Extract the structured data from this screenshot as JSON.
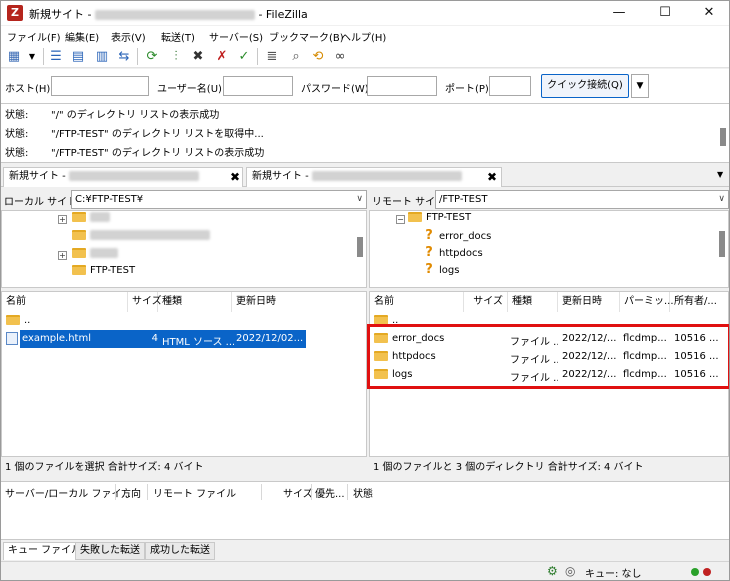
{
  "window": {
    "title_prefix": "新規サイト - ",
    "title_suffix": " - FileZilla",
    "app_icon": "Z"
  },
  "window_controls": {
    "minimize": "—",
    "maximize": "☐",
    "close": "✕"
  },
  "menu": [
    "ファイル(F)",
    "編集(E)",
    "表示(V)",
    "転送(T)",
    "サーバー(S)",
    "ブックマーク(B)",
    "ヘルプ(H)"
  ],
  "quickconnect": {
    "host_label": "ホスト(H):",
    "host_value": "",
    "user_label": "ユーザー名(U):",
    "user_value": "",
    "password_label": "パスワード(W):",
    "password_value": "",
    "port_label": "ポート(P):",
    "port_value": "",
    "connect_button": "クイック接続(Q)",
    "dropdown_arrow": "▼"
  },
  "log": [
    {
      "label": "状態:",
      "message": "\"/\" のディレクトリ リストの表示成功"
    },
    {
      "label": "状態:",
      "message": "\"/FTP-TEST\" のディレクトリ リストを取得中..."
    },
    {
      "label": "状態:",
      "message": "\"/FTP-TEST\" のディレクトリ リストの表示成功"
    }
  ],
  "tabs": [
    {
      "label": "新規サイト - ",
      "close": "✖"
    },
    {
      "label": "新規サイト - ",
      "close": "✖"
    }
  ],
  "local": {
    "site_label": "ローカル サイト:",
    "path": "C:¥FTP-TEST¥",
    "tree": [
      {
        "label": ""
      },
      {
        "label": ""
      },
      {
        "label": ""
      },
      {
        "label": "FTP-TEST"
      }
    ],
    "columns": [
      "名前",
      "サイズ",
      "種類",
      "更新日時"
    ],
    "files": [
      {
        "name": "..",
        "size": "",
        "type": "",
        "modified": ""
      },
      {
        "name": "example.html",
        "size": "4",
        "type": "HTML ソース ...",
        "modified": "2022/12/02..."
      }
    ],
    "status": "1 個のファイルを選択 合計サイズ: 4 バイト"
  },
  "remote": {
    "site_label": "リモート サイト:",
    "path": "/FTP-TEST",
    "tree": [
      {
        "label": "FTP-TEST"
      },
      {
        "label": "error_docs"
      },
      {
        "label": "httpdocs"
      },
      {
        "label": "logs"
      }
    ],
    "columns": [
      "名前",
      "サイズ",
      "種類",
      "更新日時",
      "パーミッ...",
      "所有者/..."
    ],
    "files": [
      {
        "name": "..",
        "size": "",
        "type": "",
        "modified": "",
        "perms": "",
        "owner": ""
      },
      {
        "name": "error_docs",
        "size": "",
        "type": "ファイル ...",
        "modified": "2022/12/...",
        "perms": "flcdmp...",
        "owner": "10516 ..."
      },
      {
        "name": "httpdocs",
        "size": "",
        "type": "ファイル ...",
        "modified": "2022/12/...",
        "perms": "flcdmp...",
        "owner": "10516 ..."
      },
      {
        "name": "logs",
        "size": "",
        "type": "ファイル ...",
        "modified": "2022/12/...",
        "perms": "flcdmp...",
        "owner": "10516 ..."
      }
    ],
    "status": "1 個のファイルと 3 個のディレクトリ 合計サイズ: 4 バイト"
  },
  "queue": {
    "columns": [
      "サーバー/ローカル ファイ...",
      "方向",
      "リモート ファイル",
      "サイズ",
      "優先...",
      "状態"
    ],
    "tabs": [
      "キュー ファイル",
      "失敗した転送",
      "成功した転送"
    ]
  },
  "statusbar": {
    "queue_text": "キュー: なし"
  },
  "colors": {
    "highlight": "#e01010",
    "selection": "#0a64c8"
  }
}
